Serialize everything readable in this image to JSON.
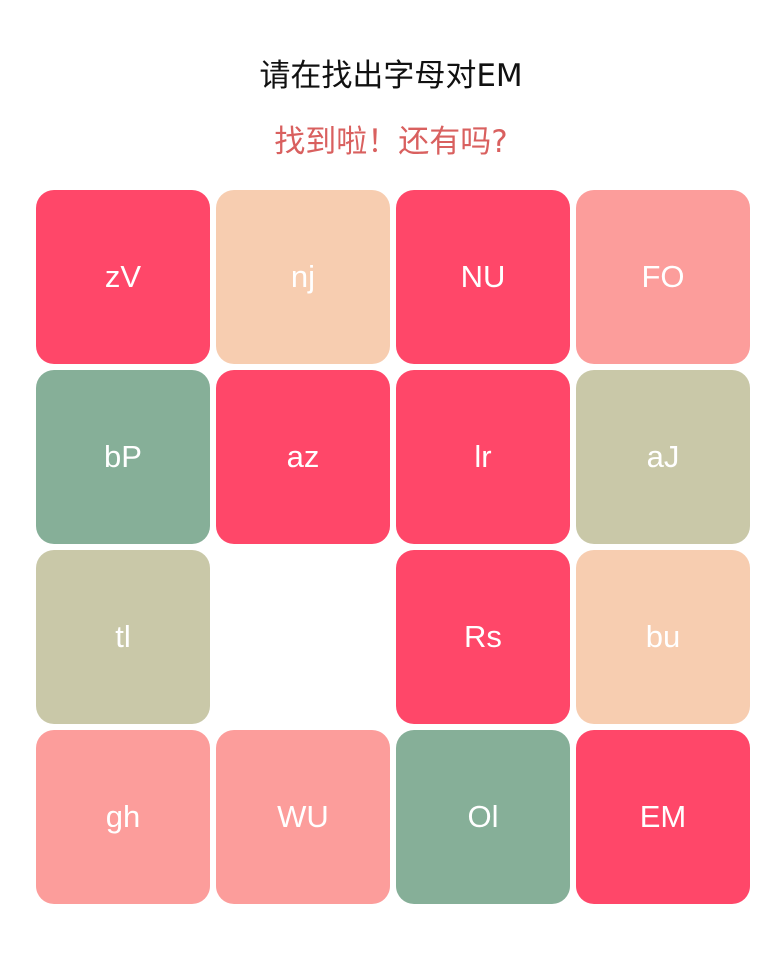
{
  "header": {
    "title": "请在找出字母对EM",
    "feedback": "找到啦！还有吗?"
  },
  "colors": {
    "red": "#ff4769",
    "peach": "#f7cdb0",
    "salmon": "#fc9d9b",
    "sage": "#86af98",
    "khaki": "#c9c8a8",
    "feedback": "#d9605f"
  },
  "grid": {
    "tiles": [
      {
        "label": "zV",
        "color": "red",
        "empty": false
      },
      {
        "label": "nj",
        "color": "peach",
        "empty": false
      },
      {
        "label": "NU",
        "color": "red",
        "empty": false
      },
      {
        "label": "FO",
        "color": "salmon",
        "empty": false
      },
      {
        "label": "bP",
        "color": "sage",
        "empty": false
      },
      {
        "label": "az",
        "color": "red",
        "empty": false
      },
      {
        "label": "lr",
        "color": "red",
        "empty": false
      },
      {
        "label": "aJ",
        "color": "khaki",
        "empty": false
      },
      {
        "label": "tl",
        "color": "khaki",
        "empty": false
      },
      {
        "label": "",
        "color": "",
        "empty": true
      },
      {
        "label": "Rs",
        "color": "red",
        "empty": false
      },
      {
        "label": "bu",
        "color": "peach",
        "empty": false
      },
      {
        "label": "gh",
        "color": "salmon",
        "empty": false
      },
      {
        "label": "WU",
        "color": "salmon",
        "empty": false
      },
      {
        "label": "Ol",
        "color": "sage",
        "empty": false
      },
      {
        "label": "EM",
        "color": "red",
        "empty": false
      }
    ]
  }
}
